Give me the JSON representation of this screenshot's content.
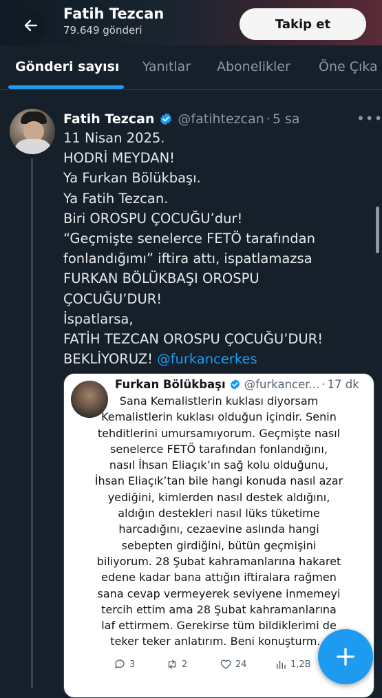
{
  "header": {
    "title": "Fatih Tezcan",
    "post_count": "79.649 gönderi",
    "follow_label": "Takip et",
    "back_icon": "arrow-left-icon"
  },
  "tabs": [
    {
      "label": "Gönderi sayısı",
      "active": true
    },
    {
      "label": "Yanıtlar",
      "active": false
    },
    {
      "label": "Abonelikler",
      "active": false
    },
    {
      "label": "Öne Çıka",
      "active": false
    }
  ],
  "tweet": {
    "author_name": "Fatih Tezcan",
    "handle": "@fatihtezcan",
    "separator": "·",
    "time": "5 sa",
    "more_icon": "more-horizontal-icon",
    "lines": [
      "11 Nisan 2025.",
      "HODRİ MEYDAN!",
      "Ya Furkan Bölükbaşı.",
      "Ya Fatih Tezcan.",
      "Biri OROSPU ÇOCUĞU’dur!",
      "“Geçmişte senelerce FETÖ tarafından",
      "fonlandığımı” iftira attı, ispatlamazsa",
      "FURKAN BÖLÜKBAŞI OROSPU",
      "ÇOCUĞU’DUR!",
      "İspatlarsa,",
      "FATİH TEZCAN OROSPU ÇOCUĞU’DUR!"
    ],
    "last_line_prefix": "BEKLİYORUZ!",
    "mention": "@furkancerkes"
  },
  "quote": {
    "author_name": "Furkan Bölükbaşı",
    "handle": "@furkancer...",
    "separator": "·",
    "time": "17 dk",
    "lines": [
      "Sana Kemalistlerin kuklası diyorsam",
      "Kemalistlerin kuklası olduğun içindir. Senin",
      "tehditlerini umursamıyorum. Geçmişte nasıl",
      "senelerce FETÖ tarafından fonlandığını,",
      "nasıl İhsan Eliaçık’ın sağ kolu olduğunu,",
      "İhsan Eliaçık’tan bile hangi konuda nasıl azar",
      "yediğini, kimlerden nasıl destek aldığını,",
      "aldığın destekleri nasıl lüks tüketime",
      "harcadığını, cezaevine aslında hangi",
      "sebepten girdiğini, bütün geçmişini",
      "biliyorum. 28 Şubat kahramanlarına hakaret",
      "edene kadar bana attığın iftiralara rağmen",
      "sana cevap vermeyerek seviyene inmemeyi",
      "tercih ettim ama 28 Şubat kahramanlarına",
      "laf ettirmem. Gerekirse tüm bildiklerimi de",
      "teker teker anlatırım. Beni konuşturm..."
    ],
    "actions": {
      "replies": "3",
      "retweets": "2",
      "likes": "24",
      "views": "1,2B"
    }
  },
  "fab_icon": "plus-icon",
  "colors": {
    "background": "#15202b",
    "accent": "#1d9bf0",
    "muted": "#8b98a5"
  }
}
